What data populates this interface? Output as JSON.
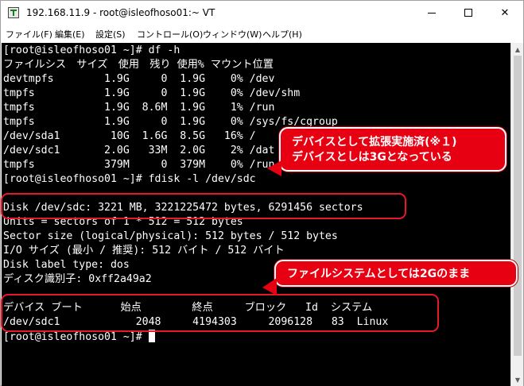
{
  "window": {
    "title": "192.168.11.9 - root@isleofhoso01:~ VT",
    "controls": {
      "minimize": "—",
      "maximize": "☐",
      "close": "✕"
    }
  },
  "menu": [
    "ファイル(F)",
    "編集(E)",
    "設定(S)",
    "コントロール(O)",
    "ウィンドウ(W)",
    "ヘルプ(H)"
  ],
  "terminal": {
    "lines": [
      "[root@isleofhoso01 ~]# df -h",
      "ファイルシス　サイズ　使用　残り 使用% マウント位置",
      "devtmpfs        1.9G     0  1.9G    0% /dev",
      "tmpfs           1.9G     0  1.9G    0% /dev/shm",
      "tmpfs           1.9G  8.6M  1.9G    1% /run",
      "tmpfs           1.9G     0  1.9G    0% /sys/fs/cgroup",
      "/dev/sda1        10G  1.6G  8.5G   16% /",
      "/dev/sdc1       2.0G   33M  2.0G    2% /dat",
      "tmpfs           379M     0  379M    0% /run",
      "[root@isleofhoso01 ~]# fdisk -l /dev/sdc",
      "",
      "Disk /dev/sdc: 3221 MB, 3221225472 bytes, 6291456 sectors",
      "Units = sectors of 1 * 512 = 512 bytes",
      "Sector size (logical/physical): 512 bytes / 512 bytes",
      "I/O サイズ (最小 / 推奨): 512 バイト / 512 バイト",
      "Disk label type: dos",
      "ディスク識別子: 0xff2a49a2",
      "",
      "デバイス ブート      始点        終点     ブロック   Id  システム",
      "/dev/sdc1            2048     4194303     2096128   83  Linux",
      "[root@isleofhoso01 ~]# "
    ]
  },
  "callouts": {
    "extension": {
      "line1": "デバイスとして拡張実施済(※１)",
      "line2": "デバイスとしは3Gとなっている"
    },
    "filesystem": {
      "text": "ファイルシステムとしては2Gのまま"
    }
  },
  "colors": {
    "terminal_bg": "#000000",
    "terminal_fg": "#ffffff",
    "annotation_red": "#e60012"
  },
  "scrollbar": {
    "up_icon": "▲",
    "down_icon": "▼"
  }
}
